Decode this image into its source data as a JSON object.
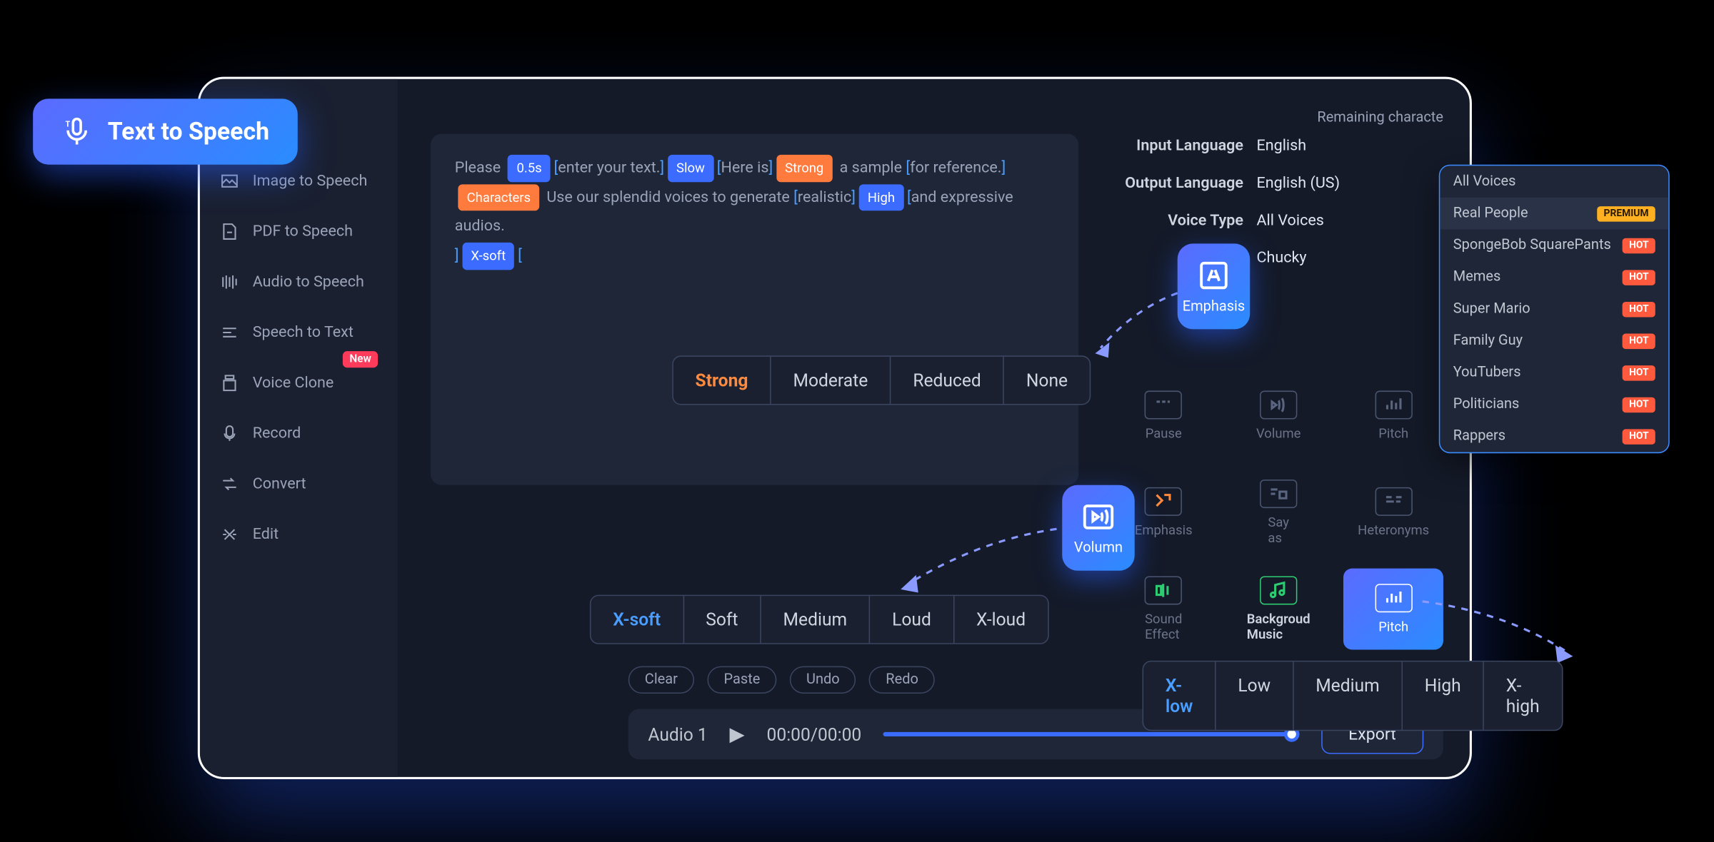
{
  "badge": {
    "title": "Text  to Speech"
  },
  "sidebar": {
    "items": [
      {
        "label": "Image to Speech",
        "icon": "image-icon"
      },
      {
        "label": "PDF to Speech",
        "icon": "pdf-icon"
      },
      {
        "label": "Audio to Speech",
        "icon": "audio-icon"
      },
      {
        "label": "Speech to Text",
        "icon": "stt-icon"
      },
      {
        "label": "Voice Clone",
        "icon": "clone-icon",
        "badge": "New"
      },
      {
        "label": "Record",
        "icon": "record-icon"
      },
      {
        "label": "Convert",
        "icon": "convert-icon"
      },
      {
        "label": "Edit",
        "icon": "edit-icon"
      }
    ]
  },
  "editor": {
    "tokens": [
      {
        "t": "text",
        "v": "Please "
      },
      {
        "t": "tag",
        "cls": "tag-blue",
        "v": "0.5s"
      },
      {
        "t": "bracket",
        "v": "["
      },
      {
        "t": "text",
        "v": "enter your text."
      },
      {
        "t": "bracket",
        "v": "]"
      },
      {
        "t": "tag",
        "cls": "tag-blue",
        "v": "Slow"
      },
      {
        "t": "bracket",
        "v": "["
      },
      {
        "t": "text",
        "v": "Here is"
      },
      {
        "t": "bracket",
        "v": "]"
      },
      {
        "t": "tag",
        "cls": "tag-orange",
        "v": "Strong"
      },
      {
        "t": "text",
        "v": " a sample "
      },
      {
        "t": "bracket",
        "v": "["
      },
      {
        "t": "text",
        "v": "for reference."
      },
      {
        "t": "bracket",
        "v": "]"
      },
      {
        "t": "br"
      },
      {
        "t": "tag",
        "cls": "tag-orange",
        "v": "Characters"
      },
      {
        "t": "text",
        "v": " Use our splendid voices to generate "
      },
      {
        "t": "bracket",
        "v": "["
      },
      {
        "t": "text",
        "v": "realistic"
      },
      {
        "t": "bracket",
        "v": "]"
      },
      {
        "t": "tag",
        "cls": "tag-blue",
        "v": "High"
      },
      {
        "t": "bracket",
        "v": "["
      },
      {
        "t": "text",
        "v": "and expressive audios."
      },
      {
        "t": "br"
      },
      {
        "t": "bracket",
        "v": "]"
      },
      {
        "t": "tag",
        "cls": "tag-blue",
        "v": "X-soft"
      },
      {
        "t": "bracket",
        "v": "["
      }
    ]
  },
  "popovers": {
    "emphasis": {
      "label": "Emphasis",
      "options": [
        "Strong",
        "Moderate",
        "Reduced",
        "None"
      ],
      "active": 0,
      "activeColor": "orange"
    },
    "volume": {
      "label": "Volumn",
      "options": [
        "X-soft",
        "Soft",
        "Medium",
        "Loud",
        "X-loud"
      ],
      "active": 0,
      "activeColor": "blue"
    },
    "pitch": {
      "label": "Pitch",
      "options": [
        "X-low",
        "Low",
        "Medium",
        "High",
        "X-high"
      ],
      "active": 0,
      "activeColor": "blue"
    }
  },
  "rightPanel": {
    "remaining": "Remaining characte",
    "rows": [
      {
        "label": "Input Language",
        "value": "English"
      },
      {
        "label": "Output Language",
        "value": "English (US)"
      },
      {
        "label": "Voice Type",
        "value": "All Voices"
      },
      {
        "label": "Voice",
        "value": "Chucky"
      }
    ]
  },
  "fxGrid": [
    {
      "label": "Pause",
      "icon": "pause"
    },
    {
      "label": "Volume",
      "icon": "volume"
    },
    {
      "label": "Pitch",
      "icon": "pitch"
    },
    {
      "label": "Emphasis",
      "icon": "emphasis",
      "accent": "orange"
    },
    {
      "label": "Say as",
      "icon": "sayas"
    },
    {
      "label": "Heteronyms",
      "icon": "hetero"
    },
    {
      "label": "Sound Effect",
      "icon": "sound",
      "accent": "green"
    },
    {
      "label": "Backgroud Music",
      "icon": "bgm",
      "accent": "green",
      "highlight": true
    },
    {
      "label": "Pitch",
      "icon": "pitch",
      "active": true
    }
  ],
  "toolbar": {
    "buttons": [
      "Clear",
      "Paste",
      "Undo",
      "Redo"
    ]
  },
  "player": {
    "track": "Audio 1",
    "time": "00:00/00:00",
    "export": "Export"
  },
  "voiceDropdown": {
    "items": [
      {
        "label": "All Voices"
      },
      {
        "label": "Real People",
        "badge": "PREMIUM",
        "badgeCls": "prem",
        "selected": true
      },
      {
        "label": "SpongeBob SquarePants",
        "badge": "HOT",
        "badgeCls": "hot"
      },
      {
        "label": "Memes",
        "badge": "HOT",
        "badgeCls": "hot"
      },
      {
        "label": "Super Mario",
        "badge": "HOT",
        "badgeCls": "hot"
      },
      {
        "label": "Family Guy",
        "badge": "HOT",
        "badgeCls": "hot"
      },
      {
        "label": "YouTubers",
        "badge": "HOT",
        "badgeCls": "hot"
      },
      {
        "label": "Politicians",
        "badge": "HOT",
        "badgeCls": "hot"
      },
      {
        "label": "Rappers",
        "badge": "HOT",
        "badgeCls": "hot"
      }
    ]
  }
}
